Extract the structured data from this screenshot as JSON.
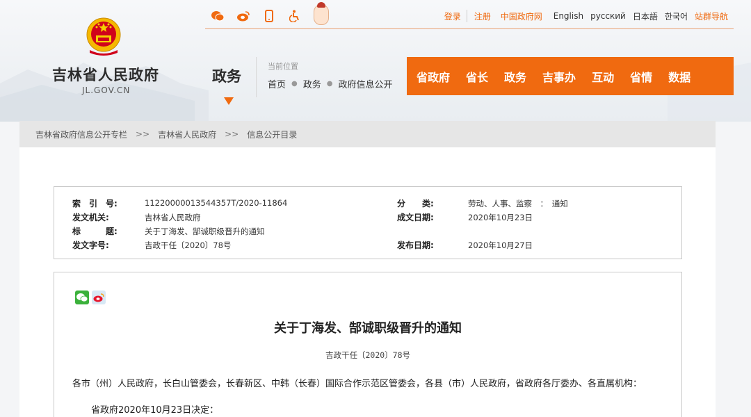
{
  "header": {
    "site_title": "吉林省人民政府",
    "site_domain": "JL.GOV.CN",
    "section": "政务",
    "position_label": "当前位置",
    "position_crumbs": [
      "首页",
      "政务",
      "政府信息公开"
    ]
  },
  "topbar": {
    "icons": [
      "weibo-icon",
      "weibo-icon",
      "mobile-icon",
      "accessibility-icon",
      "mascot-icon"
    ],
    "login": "登录",
    "register": "注册",
    "gov_cn": "中国政府网",
    "english": "English",
    "russian": "русский",
    "japanese": "日本語",
    "korean": "한국어",
    "site_nav": "站群导航"
  },
  "mainnav": [
    "省政府",
    "省长",
    "政务",
    "吉事办",
    "互动",
    "省情",
    "数据"
  ],
  "breadcrumb": [
    "吉林省政府信息公开专栏",
    "吉林省人民政府",
    "信息公开目录"
  ],
  "breadcrumb_sep": ">>",
  "info": {
    "index_label": "索　引　号:",
    "index_value": "11220000013544357T/2020-11864",
    "issuer_label": "发文机关:",
    "issuer_value": "吉林省人民政府",
    "title_label": "标　　　题:",
    "title_value": "关于丁海发、郜诚职级晋升的通知",
    "docno_label": "发文字号:",
    "docno_value": "吉政干任〔2020〕78号",
    "category_label": "分　　类:",
    "category_value": "劳动、人事、监察　：　通知",
    "written_label": "成文日期:",
    "written_value": "2020年10月23日",
    "published_label": "发布日期:",
    "published_value": "2020年10月27日"
  },
  "article": {
    "title": "关于丁海发、郜诚职级晋升的通知",
    "doc_number": "吉政干任〔2020〕78号",
    "recipients": "各市（州）人民政府，长白山管委会，长春新区、中韩（长春）国际合作示范区管委会，各县（市）人民政府，省政府各厅委办、各直属机构：",
    "decision": "省政府2020年10月23日决定："
  },
  "colors": {
    "accent": "#f06a10",
    "nav_bg": "#f06a10",
    "crumb_bg": "#e6e6e6"
  }
}
